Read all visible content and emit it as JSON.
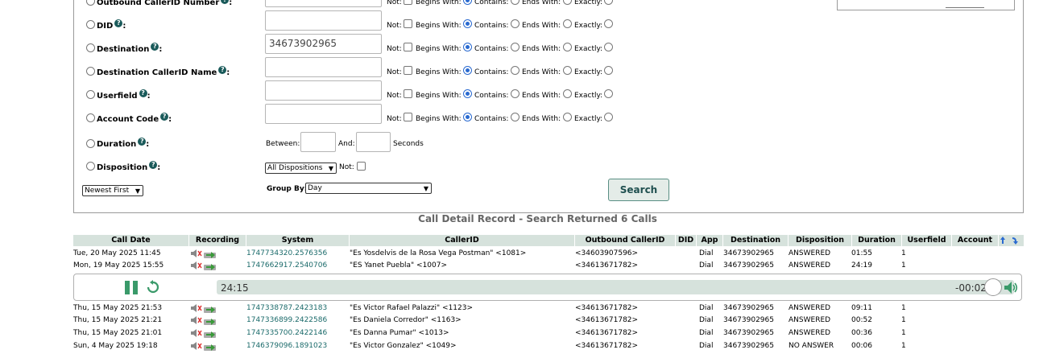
{
  "filters": {
    "rows": [
      {
        "label": "Outbound CallerID Number",
        "value": "",
        "not": "Not:",
        "begins": "Begins With:",
        "contains": "Contains:",
        "ends": "Ends With:",
        "exactly": "Exactly:"
      },
      {
        "label": "DID",
        "value": "",
        "not": "Not:",
        "begins": "Begins With:",
        "contains": "Contains:",
        "ends": "Ends With:",
        "exactly": "Exactly:"
      },
      {
        "label": "Destination",
        "value": "34673902965",
        "not": "Not:",
        "begins": "Begins With:",
        "contains": "Contains:",
        "ends": "Ends With:",
        "exactly": "Exactly:"
      },
      {
        "label": "Destination CallerID Name",
        "value": "",
        "not": "Not:",
        "begins": "Begins With:",
        "contains": "Contains:",
        "ends": "Ends With:",
        "exactly": "Exactly:"
      },
      {
        "label": "Userfield",
        "value": "",
        "not": "Not:",
        "begins": "Begins With:",
        "contains": "Contains:",
        "ends": "Ends With:",
        "exactly": "Exactly:"
      },
      {
        "label": "Account Code",
        "value": "",
        "not": "Not:",
        "begins": "Begins With:",
        "contains": "Contains:",
        "ends": "Ends With:",
        "exactly": "Exactly:"
      }
    ],
    "duration": {
      "label": "Duration",
      "between": "Between:",
      "and": "And:",
      "seconds": "Seconds"
    },
    "disposition": {
      "label": "Disposition",
      "selected": "All Dispositions",
      "not": "Not:"
    },
    "sort": {
      "selected": "Newest First"
    },
    "group_by": {
      "label": "Group By:",
      "selected": "Day"
    },
    "search_label": "Search",
    "help_glyph": "?",
    "colon": ":"
  },
  "summary": "Call Detail Record - Search Returned 6 Calls",
  "table": {
    "headers": [
      "Call Date",
      "Recording",
      "System",
      "CallerID",
      "Outbound CallerID",
      "DID",
      "App",
      "Destination",
      "Disposition",
      "Duration",
      "Userfield",
      "Account"
    ],
    "rows": [
      {
        "date": "Tue, 20 May 2025 11:45",
        "system": "1747734320.2576356",
        "callerid": "\"Es Yosdelvis de la Rosa Vega Postman\" <1081>",
        "outbound": "<34603907596>",
        "did": "",
        "app": "Dial",
        "destination": "34673902965",
        "disposition": "ANSWERED",
        "duration": "01:55",
        "userfield": "1",
        "account": ""
      },
      {
        "date": "Mon, 19 May 2025 15:55",
        "system": "1747662917.2540706",
        "callerid": "\"ES Yanet Puebla\" <1007>",
        "outbound": "<34613671782>",
        "did": "",
        "app": "Dial",
        "destination": "34673902965",
        "disposition": "ANSWERED",
        "duration": "24:19",
        "userfield": "1",
        "account": ""
      },
      {
        "date": "Thu, 15 May 2025 21:53",
        "system": "1747338787.2423183",
        "callerid": "\"Es Victor Rafael Palazzi\" <1123>",
        "outbound": "<34613671782>",
        "did": "",
        "app": "Dial",
        "destination": "34673902965",
        "disposition": "ANSWERED",
        "duration": "09:11",
        "userfield": "1",
        "account": ""
      },
      {
        "date": "Thu, 15 May 2025 21:21",
        "system": "1747336899.2422586",
        "callerid": "\"Es Daniela Corredor\" <1163>",
        "outbound": "<34613671782>",
        "did": "",
        "app": "Dial",
        "destination": "34673902965",
        "disposition": "ANSWERED",
        "duration": "00:52",
        "userfield": "1",
        "account": ""
      },
      {
        "date": "Thu, 15 May 2025 21:01",
        "system": "1747335700.2422146",
        "callerid": "\"Es Danna Pumar\" <1013>",
        "outbound": "<34613671782>",
        "did": "",
        "app": "Dial",
        "destination": "34673902965",
        "disposition": "ANSWERED",
        "duration": "00:36",
        "userfield": "1",
        "account": ""
      },
      {
        "date": "Sun, 4 May 2025 19:18",
        "system": "1746379096.1891023",
        "callerid": "\"Es Victor Gonzalez\" <1049>",
        "outbound": "<34613671782>",
        "did": "",
        "app": "Dial",
        "destination": "34673902965",
        "disposition": "NO ANSWER",
        "duration": "00:06",
        "userfield": "1",
        "account": ""
      }
    ]
  },
  "player": {
    "current_time": "24:15",
    "remaining": "-00:02"
  },
  "colors": {
    "accent": "#1a6a6a",
    "header_bg": "#d6e2dc",
    "player_green": "#3a9a6a",
    "arrow_blue": "#2a6ad0"
  },
  "icons": {
    "recording_play": "speaker-icon",
    "recording_download": "download-arrow-icon",
    "player_pause": "pause-icon",
    "player_replay": "replay-icon",
    "player_volume": "volume-icon",
    "sort_up": "sort-up-icon",
    "sort_down": "sort-down-icon"
  }
}
